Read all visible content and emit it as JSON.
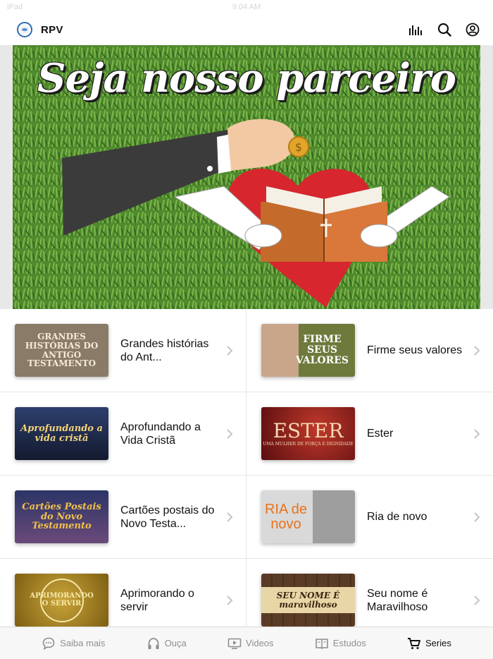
{
  "status_bar": {
    "carrier": "iPad",
    "time": "9:04 AM"
  },
  "header": {
    "title": "RPV",
    "icons": [
      "equalizer-icon",
      "search-icon",
      "account-icon"
    ]
  },
  "banner": {
    "title": "Seja nosso parceiro",
    "colors": {
      "grass": "#4f8a2e",
      "heart": "#d7262e",
      "book": "#c46b2c",
      "sleeve": "#3b3b3b"
    }
  },
  "series": [
    {
      "label": "Grandes histórias do Ant...",
      "thumb_text": "GRANDES HISTÓRIAS DO ANTIGO TESTAMENTO",
      "thumb_bg": "#8a7b66",
      "thumb_fg": "#f3ead8"
    },
    {
      "label": "Firme seus valores",
      "thumb_text": "FIRME SEUS VALORES",
      "thumb_bg": "#6e7a3c",
      "thumb_fg": "#ffffff"
    },
    {
      "label": "Aprofundando a Vida Cristã",
      "thumb_text": "Aprofundando a vida cristã",
      "thumb_bg": "#1f2a4a",
      "thumb_fg": "#f2d27a"
    },
    {
      "label": "Ester",
      "thumb_text": "ESTER",
      "thumb_sub": "UMA MULHER DE FORÇA E DIGNIDADE",
      "thumb_bg": "#8b1418",
      "thumb_fg": "#f5d9b0"
    },
    {
      "label": "Cartões postais do Novo Testa...",
      "thumb_text": "Cartões Postais do Novo Testamento",
      "thumb_bg": "#2b3566",
      "thumb_fg": "#f0c14a"
    },
    {
      "label": "Ria de novo",
      "thumb_text": "RIA de novo",
      "thumb_bg": "#d9d9d9",
      "thumb_fg": "#e8721c"
    },
    {
      "label": "Aprimorando o servir",
      "thumb_text": "APRIMORANDO O SERVIR",
      "thumb_bg": "#a8841c",
      "thumb_fg": "#f6e7a8"
    },
    {
      "label": "Seu nome é Maravilhoso",
      "thumb_text": "SEU NOME É maravilhoso",
      "thumb_bg": "#5a3b26",
      "thumb_fg": "#3b2412"
    }
  ],
  "tabs": [
    {
      "label": "Saiba mais",
      "icon": "chat-bubble-icon",
      "active": false
    },
    {
      "label": "Ouça",
      "icon": "headphones-icon",
      "active": false
    },
    {
      "label": "Videos",
      "icon": "video-icon",
      "active": false
    },
    {
      "label": "Estudos",
      "icon": "book-icon",
      "active": false
    },
    {
      "label": "Series",
      "icon": "cart-icon",
      "active": true
    }
  ],
  "colors": {
    "accent": "#111111",
    "inactive": "#8e8e8e",
    "divider": "#e6e6e6"
  }
}
